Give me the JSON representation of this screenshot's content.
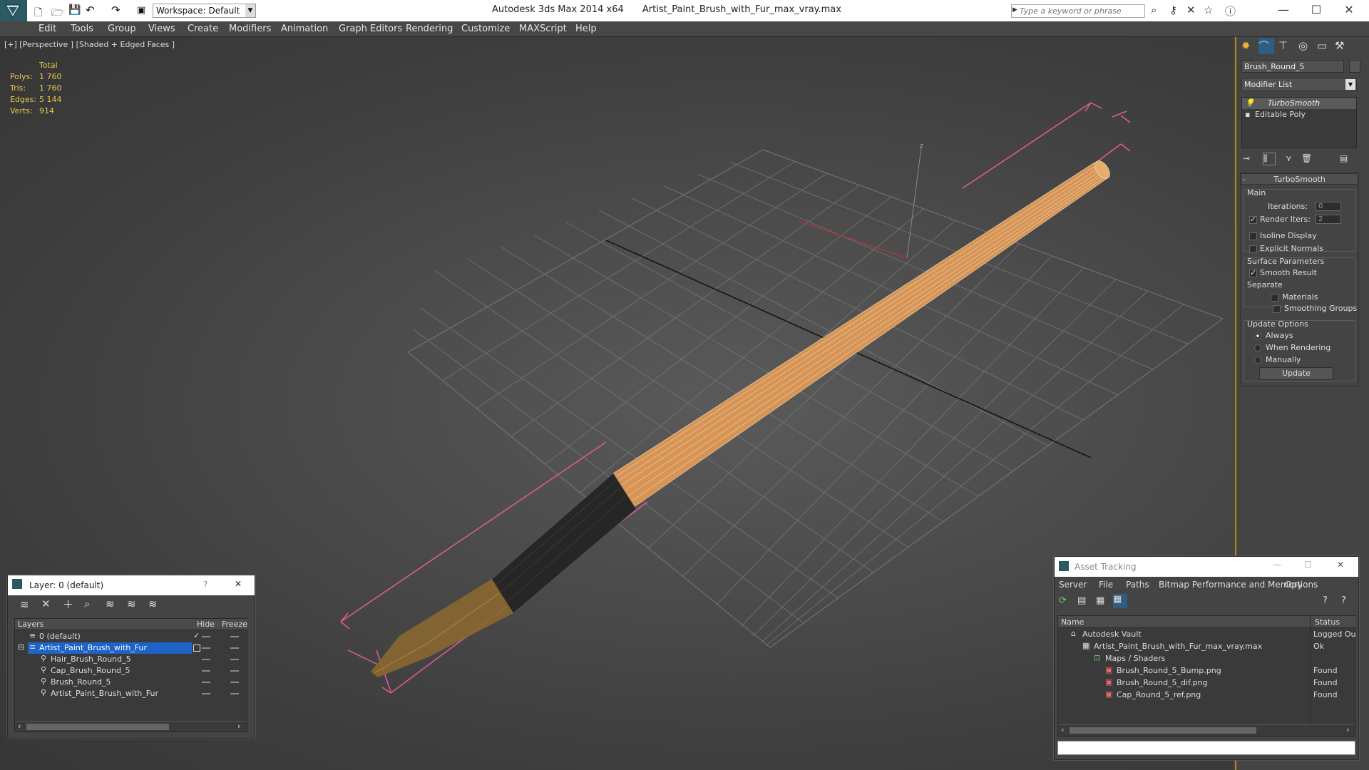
{
  "titlebar": {
    "app_title": "Autodesk 3ds Max  2014 x64",
    "file_name": "Artist_Paint_Brush_with_Fur_max_vray.max",
    "workspace": "Workspace: Default",
    "search_placeholder": "Type a keyword or phrase",
    "minimize": "—",
    "maximize": "☐",
    "close": "✕"
  },
  "menu": [
    "Edit",
    "Tools",
    "Group",
    "Views",
    "Create",
    "Modifiers",
    "Animation",
    "Graph Editors",
    "Rendering",
    "Customize",
    "MAXScript",
    "Help"
  ],
  "viewport": {
    "label": "[+] [Perspective ] [Shaded + Edged Faces ]",
    "stats": {
      "header": "Total",
      "rows": [
        {
          "label": "Polys:",
          "value": "1 760"
        },
        {
          "label": "Tris:",
          "value": "1 760"
        },
        {
          "label": "Edges:",
          "value": "5 144"
        },
        {
          "label": "Verts:",
          "value": "914"
        }
      ]
    },
    "gizmo_z": "z"
  },
  "command_panel": {
    "object_name": "Brush_Round_5",
    "modifier_list": "Modifier List",
    "stack": [
      "TurboSmooth",
      "Editable Poly"
    ],
    "rollout_title": "TurboSmooth",
    "main_label": "Main",
    "iterations_label": "Iterations:",
    "iterations_value": "0",
    "render_iters_label": "Render Iters:",
    "render_iters_value": "2",
    "isoline": "Isoline Display",
    "explicit_normals": "Explicit Normals",
    "surface_params": "Surface Parameters",
    "smooth_result": "Smooth Result",
    "separate": "Separate",
    "materials": "Materials",
    "smoothing_groups": "Smoothing Groups",
    "update_options": "Update Options",
    "always": "Always",
    "when_rendering": "When Rendering",
    "manually": "Manually",
    "update_button": "Update"
  },
  "layer_window": {
    "title": "Layer: 0 (default)",
    "help": "?",
    "close": "✕",
    "columns": [
      "Layers",
      "Hide",
      "Freeze"
    ],
    "rows": [
      {
        "name": "0 (default)",
        "indent": 0,
        "selected": false,
        "checked": true
      },
      {
        "name": "Artist_Paint_Brush_with_Fur",
        "indent": 0,
        "selected": true,
        "checked": false
      },
      {
        "name": "Hair_Brush_Round_5",
        "indent": 1,
        "selected": false,
        "checked": false
      },
      {
        "name": "Cap_Brush_Round_5",
        "indent": 1,
        "selected": false,
        "checked": false
      },
      {
        "name": "Brush_Round_5",
        "indent": 1,
        "selected": false,
        "checked": false
      },
      {
        "name": "Artist_Paint_Brush_with_Fur",
        "indent": 1,
        "selected": false,
        "checked": false
      }
    ]
  },
  "asset_window": {
    "title": "Asset Tracking",
    "menu": [
      "Server",
      "File",
      "Paths",
      "Bitmap Performance and Memory",
      "Options"
    ],
    "columns": [
      "Name",
      "Status"
    ],
    "rows": [
      {
        "name": "Autodesk Vault",
        "status": "Logged Ou",
        "indent": 0
      },
      {
        "name": "Artist_Paint_Brush_with_Fur_max_vray.max",
        "status": "Ok",
        "indent": 1
      },
      {
        "name": "Maps / Shaders",
        "status": "",
        "indent": 2
      },
      {
        "name": "Brush_Round_5_Bump.png",
        "status": "Found",
        "indent": 3
      },
      {
        "name": "Brush_Round_5_dif.png",
        "status": "Found",
        "indent": 3
      },
      {
        "name": "Cap_Round_5_ref.png",
        "status": "Found",
        "indent": 3
      }
    ]
  },
  "colors": {
    "accent": "#b8861b",
    "selection": "#1e63c7",
    "stats_text": "#e8c84a"
  }
}
